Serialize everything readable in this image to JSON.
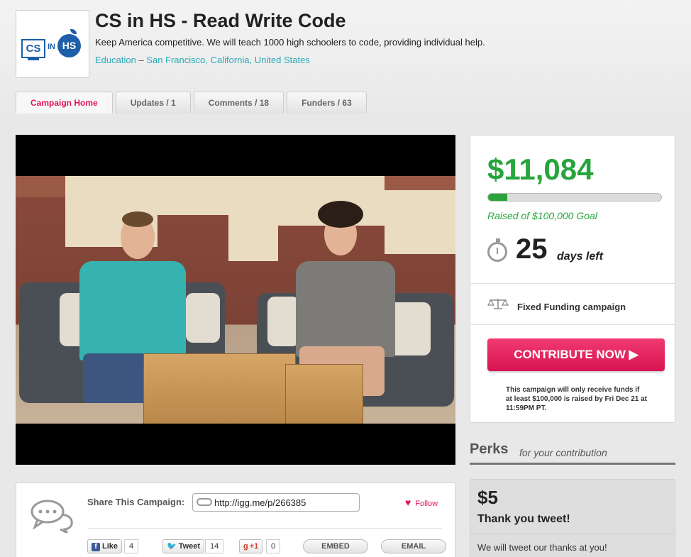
{
  "campaign": {
    "logo_text": {
      "cs": "CS",
      "in": "IN",
      "hs": "HS"
    },
    "title": "CS in HS - Read Write Code",
    "tagline": "Keep America competitive. We will teach 1000 high schoolers to code, providing individual help.",
    "category": "Education",
    "separator": " – ",
    "location": "San Francisco, California, United States"
  },
  "tabs": [
    {
      "label": "Campaign Home",
      "active": true
    },
    {
      "label": "Updates / 1"
    },
    {
      "label": "Comments / 18"
    },
    {
      "label": "Funders / 63"
    }
  ],
  "funding": {
    "amount": "$11,084",
    "progress_fraction": 0.11,
    "goal_text": "Raised of $100,000 Goal",
    "days": "25",
    "days_label": "days left",
    "funding_type": "Fixed Funding campaign",
    "cta_label": "CONTRIBUTE NOW ▶",
    "notice": "This campaign will only receive funds if at least $100,000 is raised by Fri Dec 21 at 11:59PM PT.",
    "accent_color": "#27a53d",
    "cta_color": "#e2145a"
  },
  "perks": {
    "title": "Perks",
    "subtitle": "for your contribution",
    "items": [
      {
        "price": "$5",
        "name": "Thank you tweet!",
        "description": "We will tweet our thanks at you!"
      }
    ]
  },
  "share": {
    "label": "Share This Campaign:",
    "url": "http://igg.me/p/266385",
    "follow_label": "Follow",
    "like_label": "Like",
    "like_count": "4",
    "tweet_label": "Tweet",
    "tweet_count": "14",
    "plusone_label": "+1",
    "plusone_count": "0",
    "embed_label": "EMBED",
    "email_label": "EMAIL"
  },
  "icons": [
    "stopwatch-icon",
    "scale-icon",
    "chat-bubbles-icon",
    "link-icon",
    "heart-icon",
    "facebook-icon",
    "twitter-icon",
    "google-plus-icon"
  ]
}
